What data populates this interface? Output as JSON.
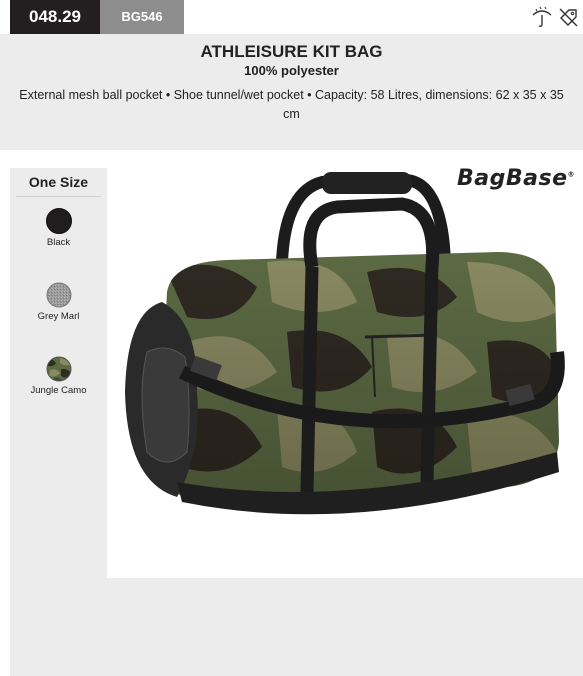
{
  "product": {
    "code": "048.29",
    "ref": "BG546",
    "title": "ATHLEISURE KIT BAG",
    "material": "100% polyester",
    "description": "External mesh ball pocket • Shoe tunnel/wet pocket • Capacity: 58 Litres, dimensions: 62 x 35 x 35 cm"
  },
  "sidebar": {
    "size_label": "One Size",
    "colors": [
      {
        "name": "Black",
        "hex": "#1f1d1e"
      },
      {
        "name": "Grey Marl",
        "hex": "#9a9a9a"
      },
      {
        "name": "Jungle Camo",
        "hex": "#4f5a3c"
      }
    ]
  },
  "brand": {
    "name": "BagBase",
    "mark": "®"
  },
  "icons": [
    "wash-care-icon",
    "no-bleach-icon"
  ],
  "colors": {
    "code_bg": "#231f20",
    "ref_bg": "#8d8d8d",
    "panel_bg": "#ececec"
  }
}
